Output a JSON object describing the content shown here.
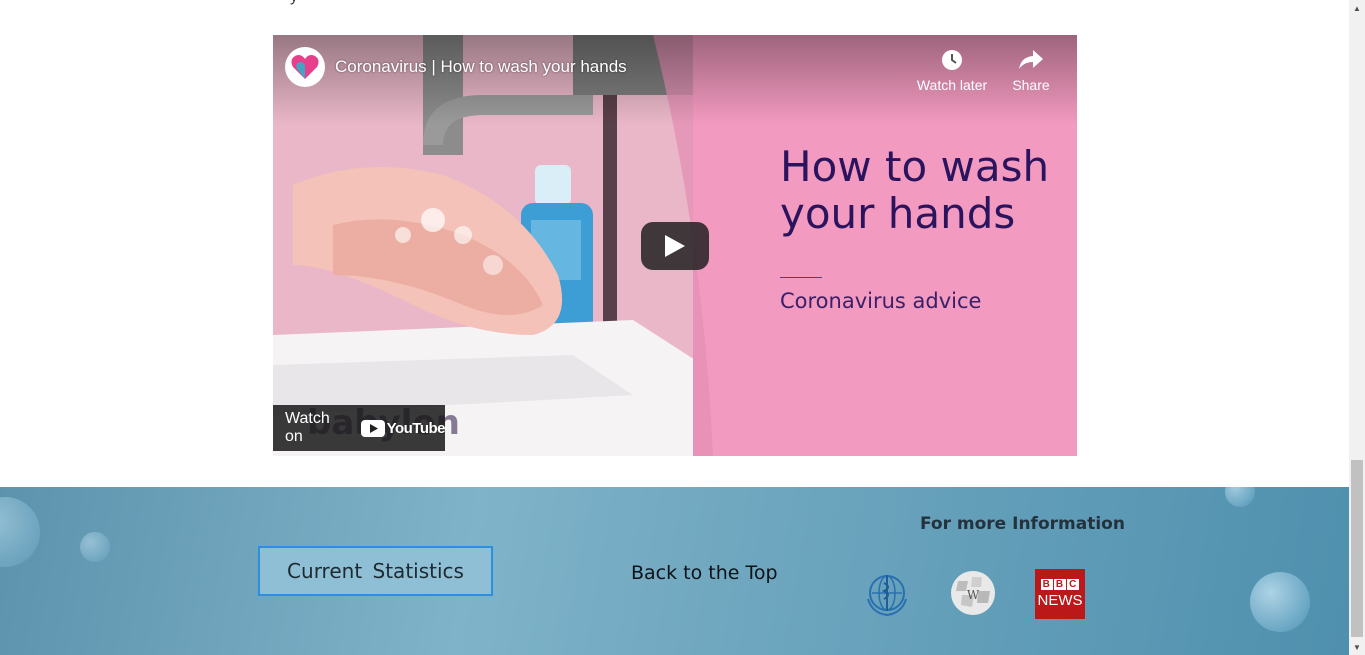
{
  "page": {
    "partial_text_above": "y"
  },
  "video": {
    "title": "Coronavirus | How to wash your hands",
    "watch_later_label": "Watch later",
    "share_label": "Share",
    "watch_on_label": "Watch on",
    "youtube_wordmark": "YouTube",
    "headline": "How to wash your hands",
    "sub_headline": "Coronavirus advice",
    "brand_watermark": "babylon"
  },
  "footer": {
    "stats_button_label": "Current Statistics",
    "back_to_top_label": "Back to the Top",
    "more_info_heading": "For more Information",
    "links": [
      {
        "name": "who-logo",
        "icon": "who-emblem-icon"
      },
      {
        "name": "wikipedia-logo",
        "icon": "wikipedia-globe-icon"
      },
      {
        "name": "bbc-news-logo",
        "top": [
          "B",
          "B",
          "C"
        ],
        "bottom": "NEWS"
      }
    ],
    "colors": {
      "background": "#6ba4bd",
      "button_border": "#2c8fe0",
      "bbc_red": "#bb1919"
    }
  },
  "icons": {
    "watch_later": "clock-icon",
    "share": "share-arrow-icon",
    "play": "play-icon"
  }
}
